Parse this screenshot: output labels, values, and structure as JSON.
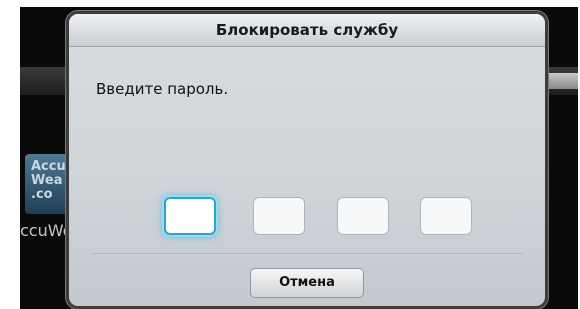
{
  "background": {
    "tile_text": [
      "Accu",
      "Wea",
      ".co"
    ],
    "caption": "ccuWe"
  },
  "dialog": {
    "title": "Блокировать службу",
    "message": "Введите пароль.",
    "pin_boxes": [
      "",
      "",
      "",
      ""
    ],
    "cancel_label": "Отмена"
  },
  "colors": {
    "focus_ring": "#2fa3c9",
    "dialog_bg": "#d3d8dd"
  }
}
